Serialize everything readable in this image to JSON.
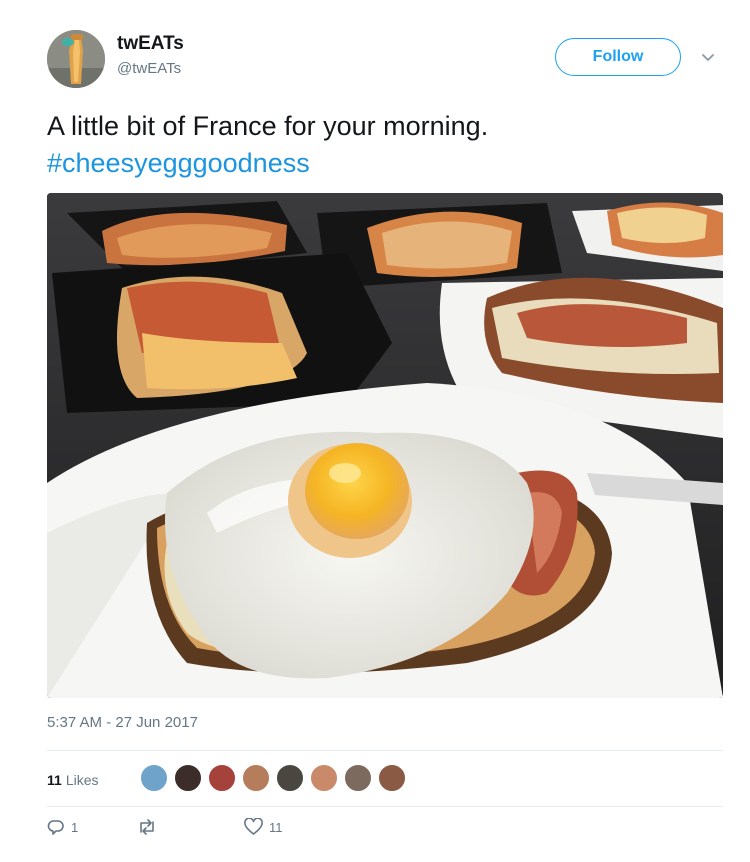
{
  "tweet": {
    "name": "twEATs",
    "handle": "@twEATs",
    "follow_label": "Follow",
    "text": "A little bit of France for your morning.",
    "hashtag": "#cheesyegggoodness",
    "timestamp": "5:37 AM - 27 Jun 2017"
  },
  "stats": {
    "likes_count": "11",
    "likes_label": "Likes",
    "liker_avatars": 8
  },
  "actions": {
    "reply_count": "1",
    "retweet_count": "",
    "like_count": "11"
  },
  "icons": {
    "reply": "reply-icon",
    "retweet": "retweet-icon",
    "like": "heart-icon",
    "more": "chevron-down-icon"
  },
  "colors": {
    "accent": "#1da1f2",
    "hashtag": "#1b95e0",
    "muted": "#657786",
    "text": "#14171a"
  }
}
